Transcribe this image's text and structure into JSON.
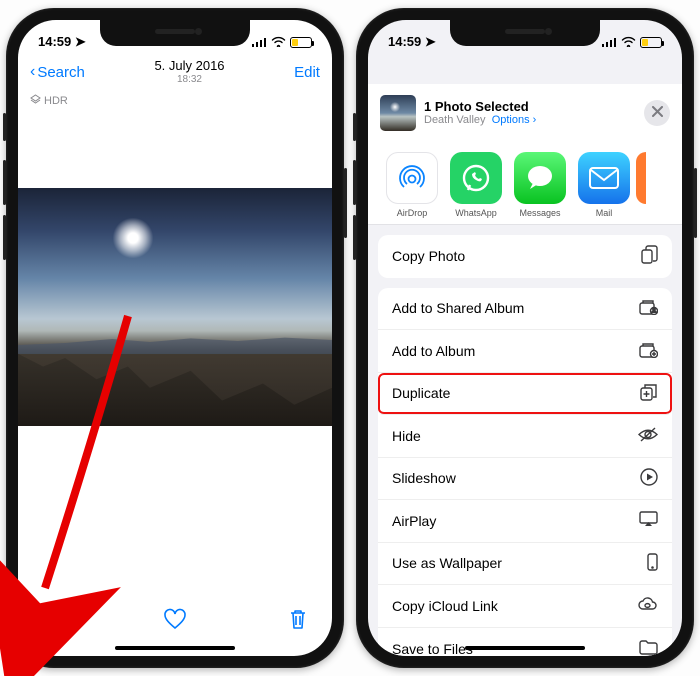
{
  "status": {
    "time": "14:59",
    "loc": "✈"
  },
  "left": {
    "back": "Search",
    "date": "5. July 2016",
    "time": "18:32",
    "edit": "Edit",
    "hdr": "HDR"
  },
  "right": {
    "title": "1 Photo Selected",
    "location": "Death Valley",
    "options": "Options",
    "apps": [
      {
        "name": "AirDrop"
      },
      {
        "name": "WhatsApp"
      },
      {
        "name": "Messages"
      },
      {
        "name": "Mail"
      }
    ],
    "single": "Copy Photo",
    "actions": [
      "Add to Shared Album",
      "Add to Album",
      "Duplicate",
      "Hide",
      "Slideshow",
      "AirPlay",
      "Use as Wallpaper",
      "Copy iCloud Link",
      "Save to Files"
    ]
  }
}
